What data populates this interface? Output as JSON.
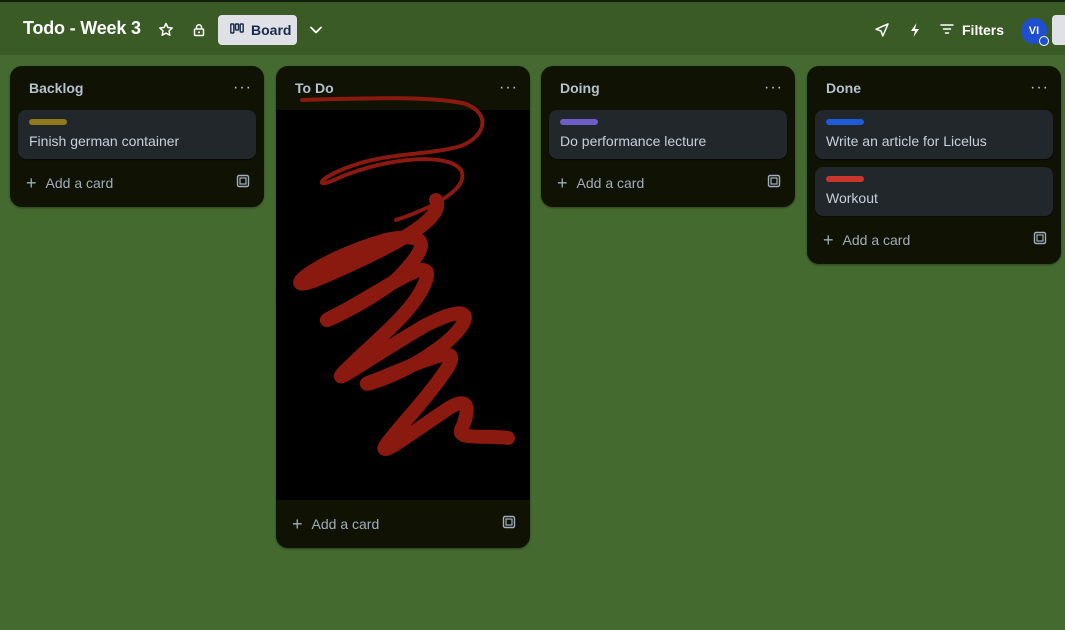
{
  "board": {
    "title": "Todo - Week 3",
    "view_label": "Board",
    "filters_label": "Filters",
    "avatar_initials": "VI"
  },
  "lists": [
    {
      "title": "Backlog",
      "more": "···",
      "add_card_label": "Add a card",
      "cards": [
        {
          "title": "Finish german container",
          "label_color": "#8f7a1c"
        }
      ]
    },
    {
      "title": "To Do",
      "more": "···",
      "add_card_label": "Add a card",
      "cards": [],
      "scribble_color": "#8a1a0f"
    },
    {
      "title": "Doing",
      "more": "···",
      "add_card_label": "Add a card",
      "cards": [
        {
          "title": "Do performance lecture",
          "label_color": "#6e5dc6"
        }
      ]
    },
    {
      "title": "Done",
      "more": "···",
      "add_card_label": "Add a card",
      "cards": [
        {
          "title": "Write an article for Licelus",
          "label_color": "#1f5ad8"
        },
        {
          "title": "Workout",
          "label_color": "#c9372c"
        }
      ]
    }
  ],
  "icons": {
    "star": "star-icon",
    "lock": "lock-icon",
    "board": "board-icon",
    "chevron": "chevron-down-icon",
    "send": "send-icon",
    "automation": "lightning-icon",
    "filter": "filter-icon",
    "template": "card-template-icon"
  }
}
